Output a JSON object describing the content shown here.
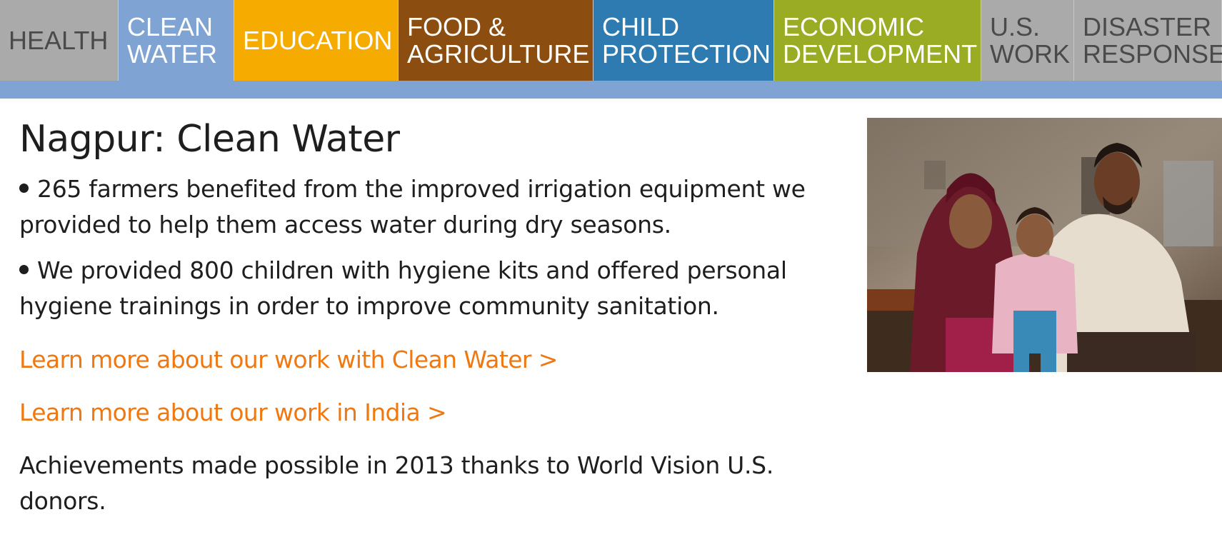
{
  "nav": {
    "tabs": [
      {
        "label": "HEALTH",
        "bg": "#aaaaaa",
        "fg": "#4a4a4a"
      },
      {
        "label": "CLEAN\nWATER",
        "bg": "#7fa3d2",
        "fg": "#ffffff"
      },
      {
        "label": "EDUCATION",
        "bg": "#f5ab00",
        "fg": "#ffffff"
      },
      {
        "label": "FOOD &\nAGRICULTURE",
        "bg": "#8c4d10",
        "fg": "#ffffff"
      },
      {
        "label": "CHILD\nPROTECTION",
        "bg": "#2e7bb1",
        "fg": "#ffffff"
      },
      {
        "label": "ECONOMIC\nDEVELOPMENT",
        "bg": "#9aac24",
        "fg": "#ffffff"
      },
      {
        "label": "U.S.\nWORK",
        "bg": "#aaaaaa",
        "fg": "#4a4a4a"
      },
      {
        "label": "DISASTER\nRESPONSE",
        "bg": "#aaaaaa",
        "fg": "#4a4a4a"
      }
    ],
    "strip_color": "#7fa3d2"
  },
  "main": {
    "title": "Nagpur: Clean Water",
    "bullets": [
      "265 farmers benefited from the improved irrigation equipment we provided to help them access water during dry seasons.",
      "We provided 800 children with hygiene kits and offered personal hygiene trainings in order to improve community sanitation."
    ],
    "links": [
      "Learn more about our work with Clean Water >",
      "Learn more about our work in India >"
    ],
    "link_color": "#f07810",
    "footer_note": "Achievements made possible in 2013 thanks to World Vision U.S. donors."
  },
  "photo": {
    "icon": "family-photo"
  }
}
